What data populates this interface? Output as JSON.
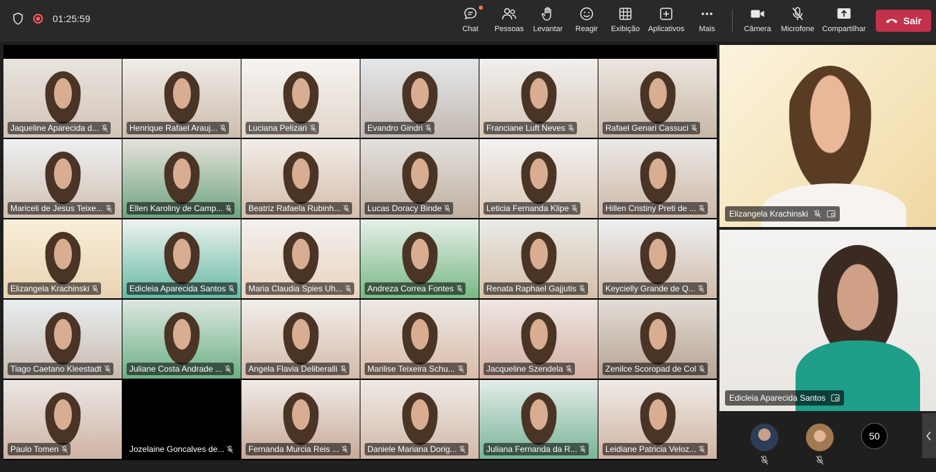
{
  "meeting": {
    "timer": "01:25:59"
  },
  "toolbar": [
    {
      "label": "Chat",
      "icon": "chat-icon"
    },
    {
      "label": "Pessoas",
      "icon": "people-icon"
    },
    {
      "label": "Levantar",
      "icon": "raise-hand-icon"
    },
    {
      "label": "Reagir",
      "icon": "react-smiley-icon"
    },
    {
      "label": "Exibição",
      "icon": "view-grid-icon"
    },
    {
      "label": "Aplicativos",
      "icon": "apps-plus-icon"
    },
    {
      "label": "Mais",
      "icon": "more-dots-icon"
    }
  ],
  "media_controls": [
    {
      "label": "Câmera",
      "icon": "camera-icon"
    },
    {
      "label": "Microfone",
      "icon": "mic-off-icon"
    },
    {
      "label": "Compartilhar",
      "icon": "share-icon"
    }
  ],
  "leave_label": "Sair",
  "participants": [
    "Jaqueline Aparecida d...",
    "Henrique Rafael Arauj...",
    "Luciana Pelizari",
    "Evandro Gindri",
    "Franciane Luft Neves",
    "Rafael Genari Cassuci",
    "Mariceli de Jesus Teixe...",
    "Ellen Karoliny de Camp...",
    "Beatriz Rafaela Rubinh...",
    "Lucas Doracy Binde",
    "Leticia Fernanda Klipe",
    "Hillen Cristiny Preti de ...",
    "Elizangela Krachinski",
    "Edicleia Aparecida Santos",
    "Maria Claudia Spies Uh...",
    "Andreza Correa Fontes",
    "Renata Raphael Gajjutis",
    "Keycielly Grande de Q...",
    "Tiago Caetano Kleestadt",
    "Juliane Costa Andrade ...",
    "Angela Flavia Deliberalli",
    "Marilise Teixeira Schu...",
    "Jacqueline Szendela",
    "Zenilce Scoropad de Col",
    "Paulo Tomen",
    "Jozelaine Goncalves de...",
    "Fernanda Murcia Reis ...",
    "Daniele Mariana Dorig...",
    "Juliana Fernanda da R...",
    "Leidiane Patricia Veloz..."
  ],
  "spotlight": [
    {
      "name": "Elizangela Krachinski"
    },
    {
      "name": "Edicleia Aparecida Santos"
    }
  ],
  "overflow_count": "50",
  "colors": {
    "leave": "#c4314b",
    "toolbar": "#292929",
    "background": "#1f1f1f"
  }
}
